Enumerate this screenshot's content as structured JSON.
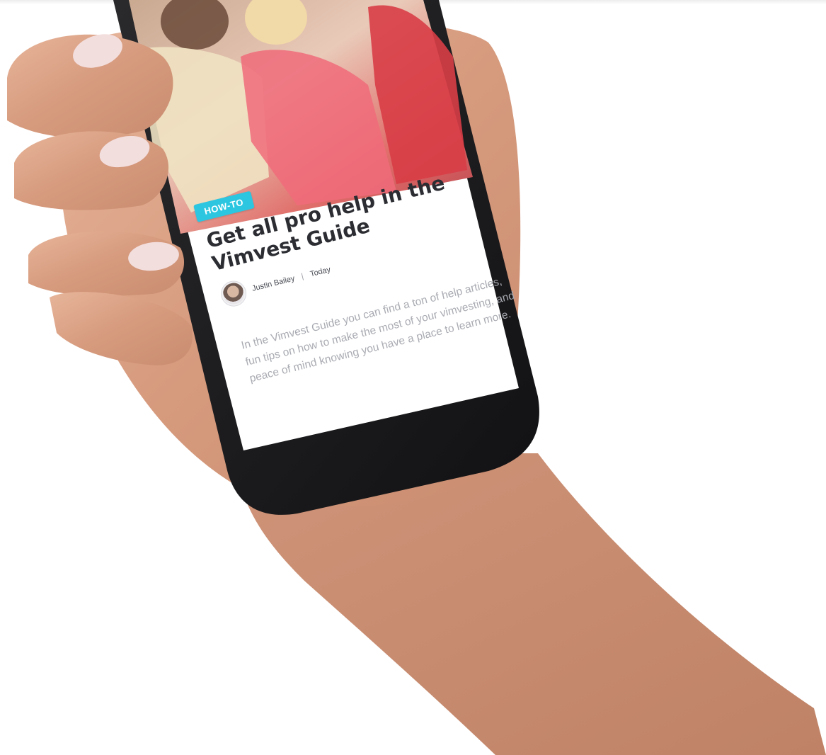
{
  "article": {
    "category": "HOW-TO",
    "title": "Get all pro help in the Vimvest Guide",
    "author": "Justin Bailey",
    "separator": "|",
    "date": "Today",
    "excerpt": "In the Vimvest Guide you can find a ton of help articles, fun tips on how to make the most of your vimvesting, and peace of mind knowing you have a place to learn more."
  },
  "colors": {
    "badge": "#2cc6e0",
    "headline": "#2b2d33",
    "excerpt": "#a9abb2",
    "phone_body": "#1a1a1c"
  }
}
